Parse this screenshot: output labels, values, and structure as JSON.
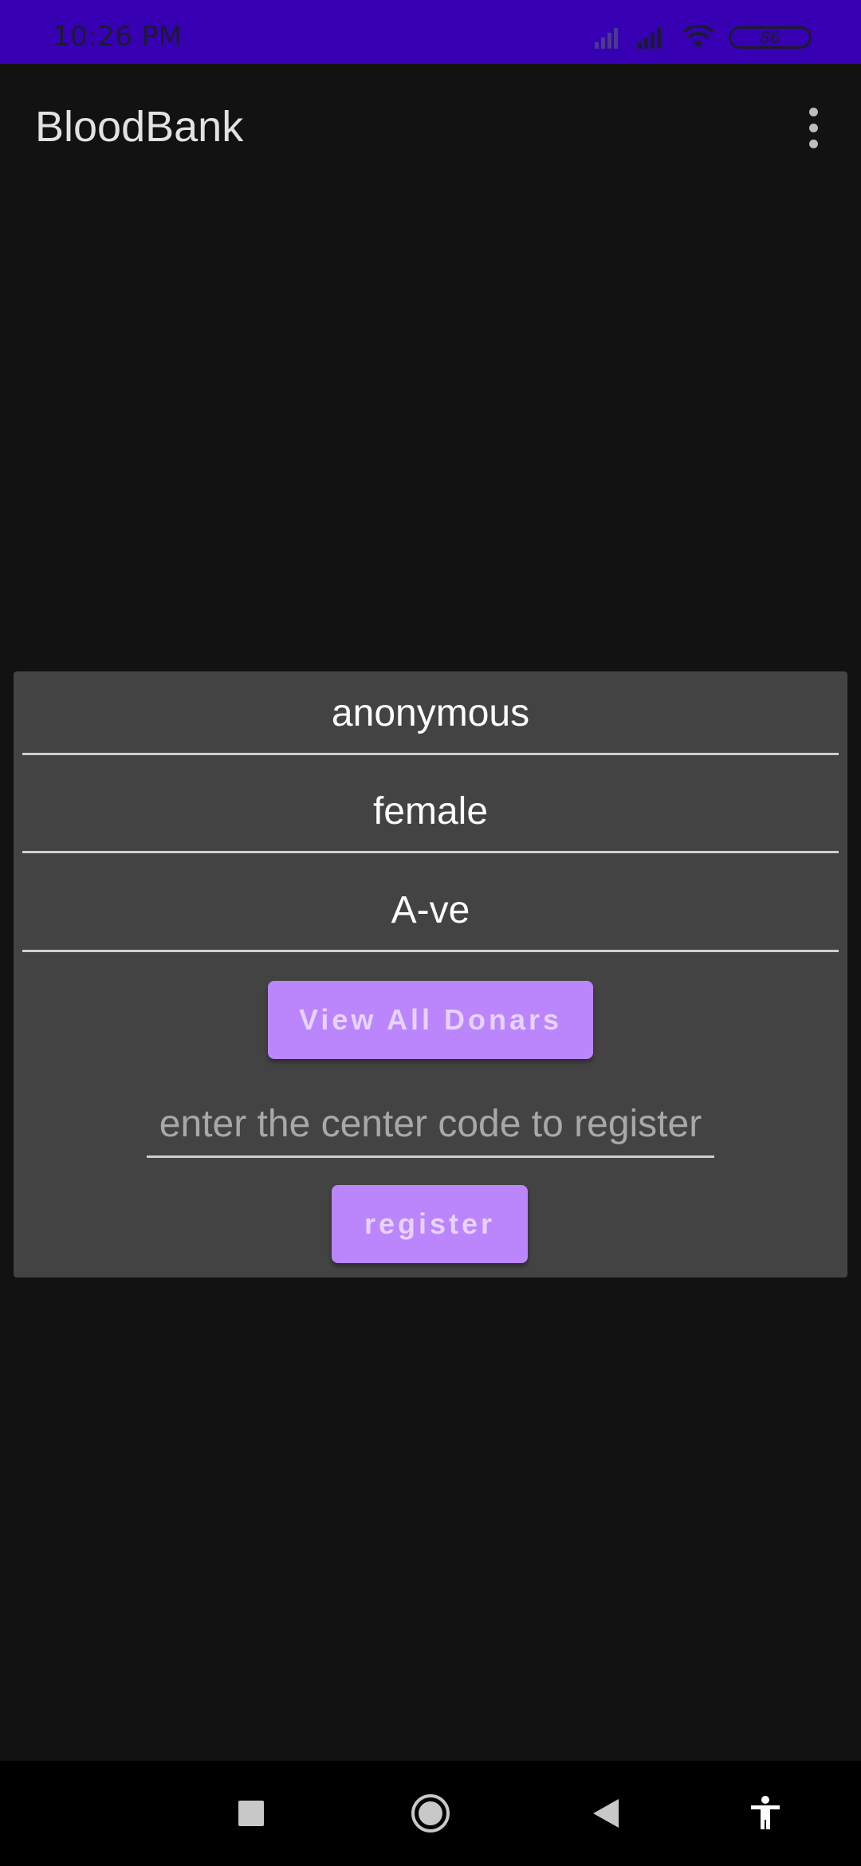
{
  "status_bar": {
    "time": "10:26 PM",
    "battery": "86",
    "icons": [
      "signal-weak-icon",
      "signal-icon",
      "wifi-icon",
      "battery-icon"
    ]
  },
  "app_bar": {
    "title": "BloodBank",
    "menu_icon": "more-vert-icon"
  },
  "donor_card": {
    "name": "anonymous",
    "gender": "female",
    "blood_group": "A-ve",
    "view_all_label": "View All Donars",
    "center_code_placeholder": "enter the center code to register",
    "register_label": "register"
  },
  "nav_bar": {
    "icons": [
      "recents-icon",
      "home-icon",
      "back-icon",
      "accessibility-icon"
    ]
  },
  "colors": {
    "status_bar": "#3700B3",
    "background": "#121212",
    "card": "#434343",
    "button": "#BB86FC"
  }
}
